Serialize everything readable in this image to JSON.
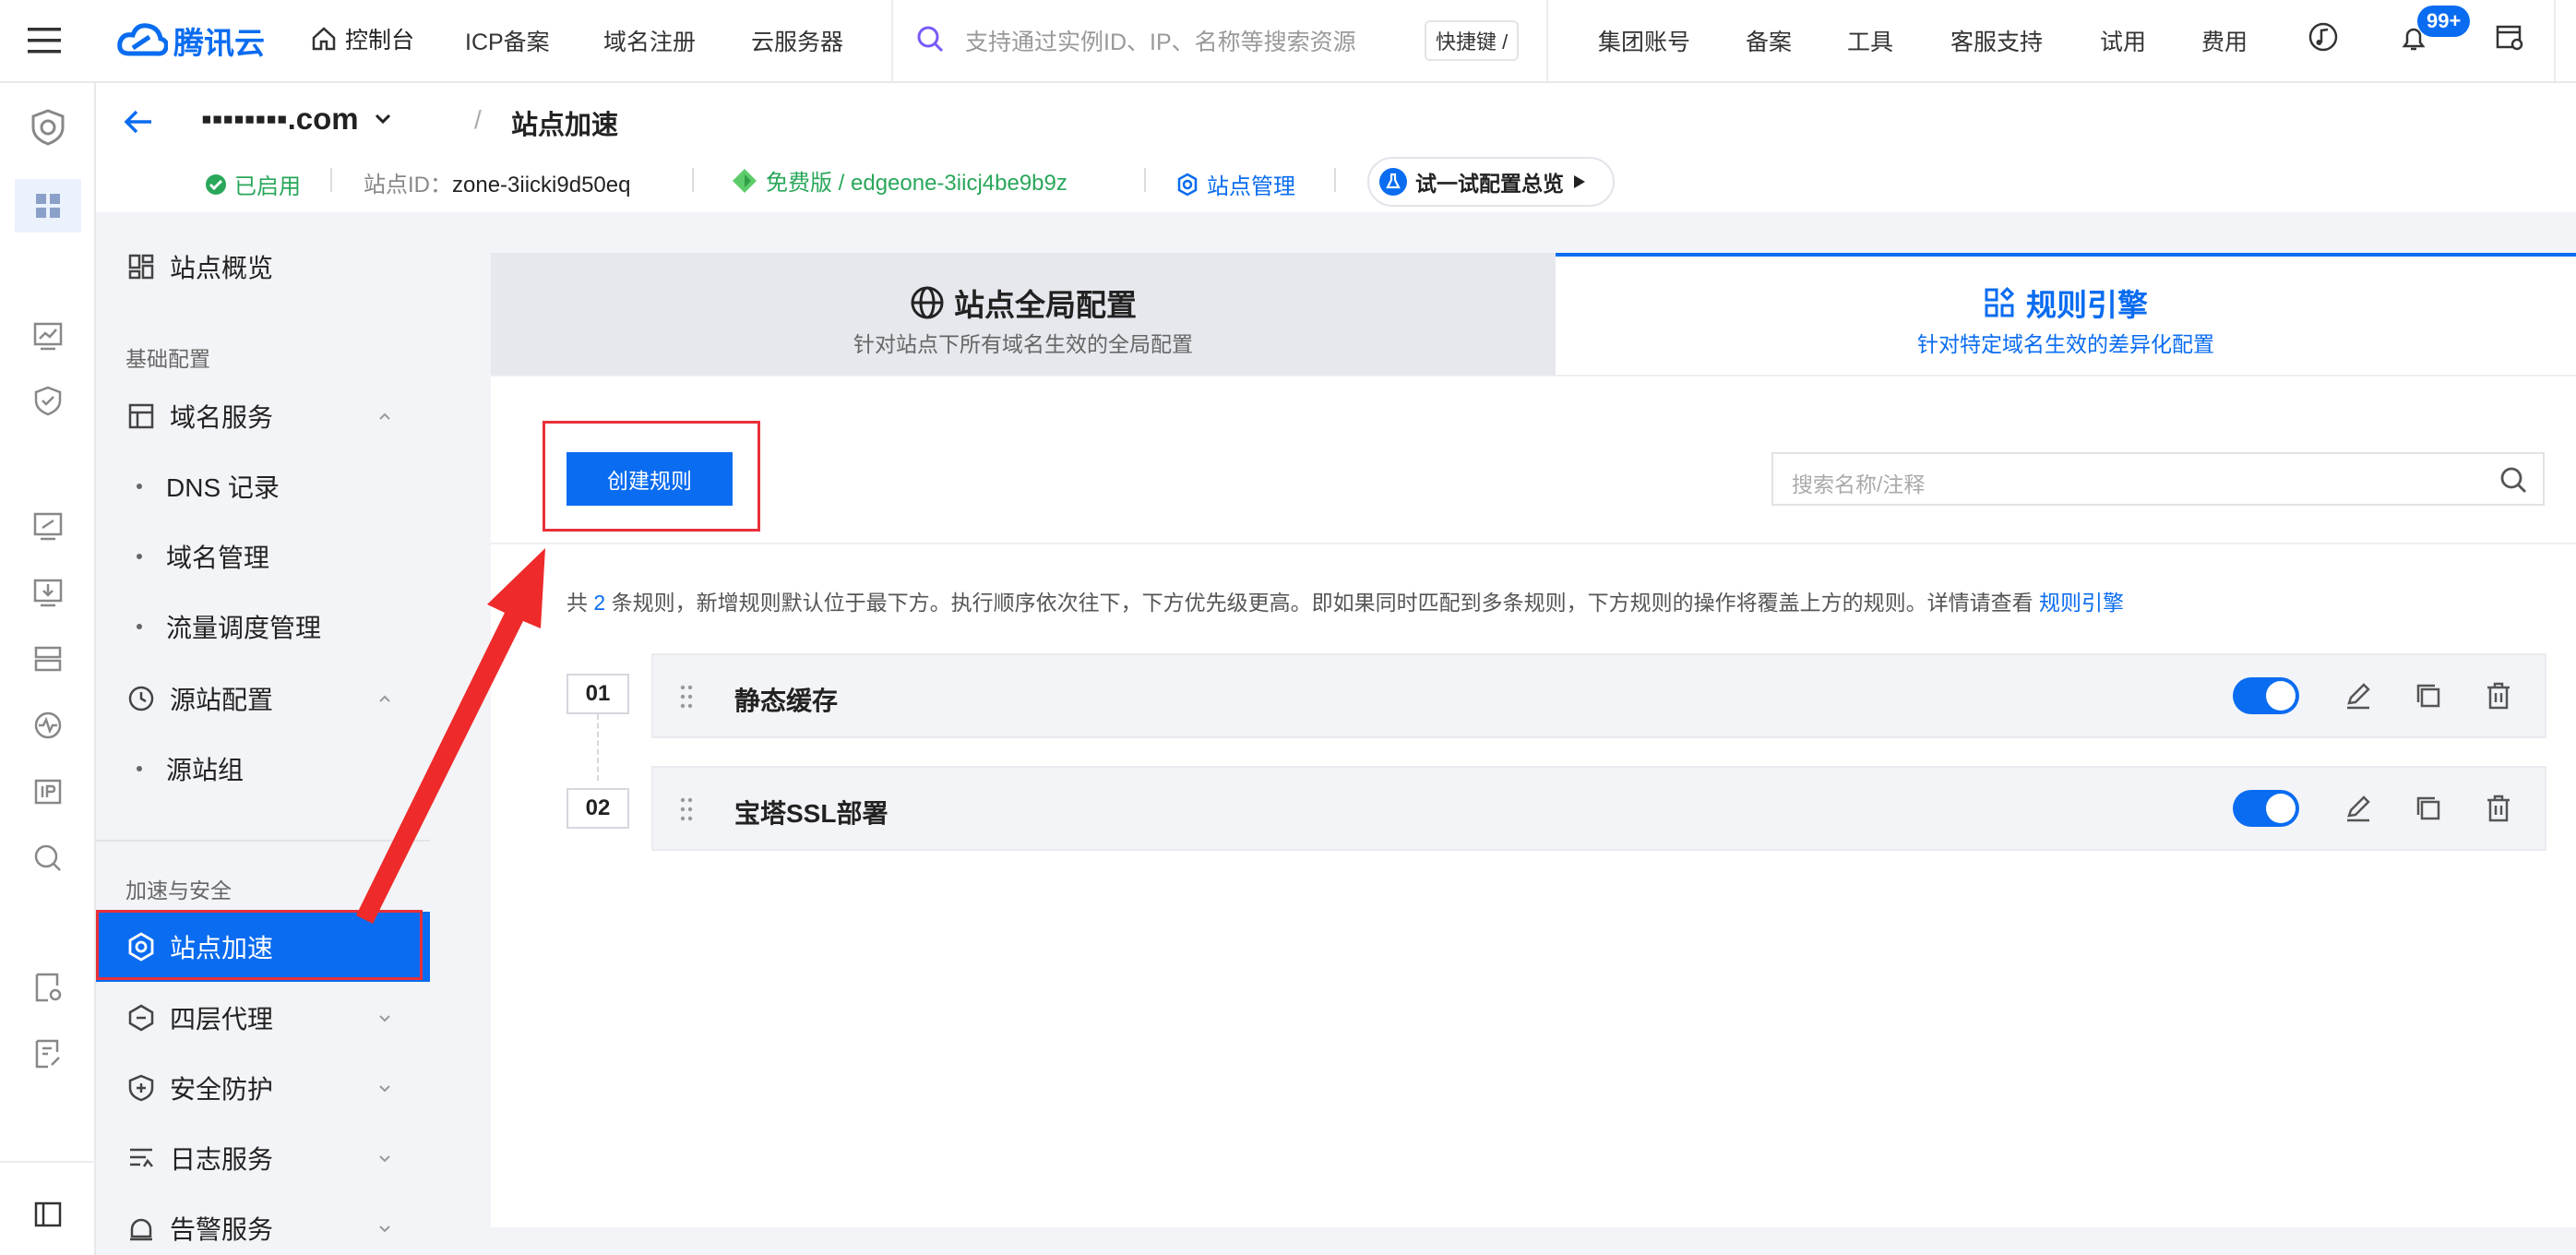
{
  "topnav": {
    "brand": "腾讯云",
    "console": "控制台",
    "items": [
      "ICP备案",
      "域名注册",
      "云服务器"
    ],
    "search_placeholder": "支持通过实例ID、IP、名称等搜索资源",
    "shortcut": "快捷键 /",
    "right_items": [
      "集团账号",
      "备案",
      "工具",
      "客服支持",
      "试用",
      "费用"
    ],
    "notification_count": "99+"
  },
  "header": {
    "domain": "▪▪▪▪▪▪▪▪.com",
    "separator": "/",
    "page_title": "站点加速",
    "status": "已启用",
    "site_id_label": "站点ID：",
    "site_id": "zone-3iicki9d50eq",
    "plan": "免费版 / edgeone-3iicj4be9b9z",
    "site_manage": "站点管理",
    "try_config": "试一试配置总览"
  },
  "sidebar": {
    "overview": "站点概览",
    "group_basic": "基础配置",
    "domain_service": "域名服务",
    "dns_records": "DNS 记录",
    "domain_manage": "域名管理",
    "traffic_manage": "流量调度管理",
    "origin_config": "源站配置",
    "origin_group": "源站组",
    "group_accel": "加速与安全",
    "site_accel": "站点加速",
    "l4_proxy": "四层代理",
    "security": "安全防护",
    "log_service": "日志服务",
    "alarm_service": "告警服务"
  },
  "tabs": {
    "global_title": "站点全局配置",
    "global_sub": "针对站点下所有域名生效的全局配置",
    "rules_title": "规则引擎",
    "rules_sub": "针对特定域名生效的差异化配置"
  },
  "main": {
    "create_rule": "创建规则",
    "search_placeholder": "搜索名称/注释",
    "info_prefix": "共",
    "rule_count": "2",
    "info_text": "条规则，新增规则默认位于最下方。执行顺序依次往下，下方优先级更高。即如果同时匹配到多条规则，下方规则的操作将覆盖上方的规则。详情请查看",
    "info_link": "规则引擎",
    "rules": [
      {
        "num": "01",
        "name": "静态缓存",
        "enabled": true
      },
      {
        "num": "02",
        "name": "宝塔SSL部署",
        "enabled": true
      }
    ]
  },
  "colors": {
    "accent": "#0a6cf0",
    "highlight": "#e8303a",
    "success": "#29a75a"
  }
}
